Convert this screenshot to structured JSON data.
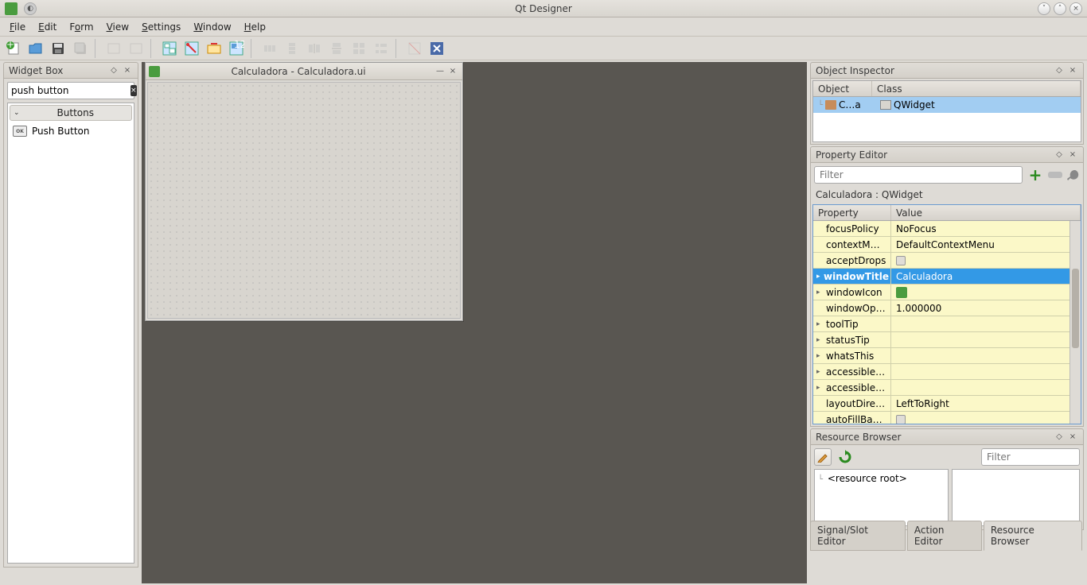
{
  "app": {
    "title": "Qt Designer"
  },
  "menu": {
    "file": "File",
    "edit": "Edit",
    "form": "Form",
    "view": "View",
    "settings": "Settings",
    "window": "Window",
    "help": "Help"
  },
  "widgetbox": {
    "title": "Widget Box",
    "search": "push button",
    "group_buttons": "Buttons",
    "item_pushbutton": "Push Button"
  },
  "form": {
    "title": "Calculadora - Calculadora.ui"
  },
  "objinsp": {
    "title": "Object Inspector",
    "col_object": "Object",
    "col_class": "Class",
    "row_object": "C…a",
    "row_class": "QWidget"
  },
  "propedit": {
    "title": "Property Editor",
    "filter_placeholder": "Filter",
    "header": "Calculadora : QWidget",
    "col_property": "Property",
    "col_value": "Value",
    "rows": [
      {
        "name": "focusPolicy",
        "value": "NoFocus",
        "exp": ""
      },
      {
        "name": "contextM…",
        "value": "DefaultContextMenu",
        "exp": ""
      },
      {
        "name": "acceptDrops",
        "value": "",
        "exp": "",
        "check": true
      },
      {
        "name": "windowTitle",
        "value": "Calculadora",
        "exp": "▸",
        "selected": true
      },
      {
        "name": "windowIcon",
        "value": "",
        "exp": "▸",
        "icon": true
      },
      {
        "name": "windowOp…",
        "value": "1.000000",
        "exp": ""
      },
      {
        "name": "toolTip",
        "value": "",
        "exp": "▸"
      },
      {
        "name": "statusTip",
        "value": "",
        "exp": "▸"
      },
      {
        "name": "whatsThis",
        "value": "",
        "exp": "▸"
      },
      {
        "name": "accessible…",
        "value": "",
        "exp": "▸"
      },
      {
        "name": "accessible…",
        "value": "",
        "exp": "▸"
      },
      {
        "name": "layoutDire…",
        "value": "LeftToRight",
        "exp": ""
      },
      {
        "name": "autoFillBa…",
        "value": "",
        "exp": "",
        "check": true
      }
    ]
  },
  "resbrowse": {
    "title": "Resource Browser",
    "filter_placeholder": "Filter",
    "root": "<resource root>"
  },
  "tabs": {
    "signal": "Signal/Slot Editor",
    "action": "Action Editor",
    "resource": "Resource Browser"
  }
}
